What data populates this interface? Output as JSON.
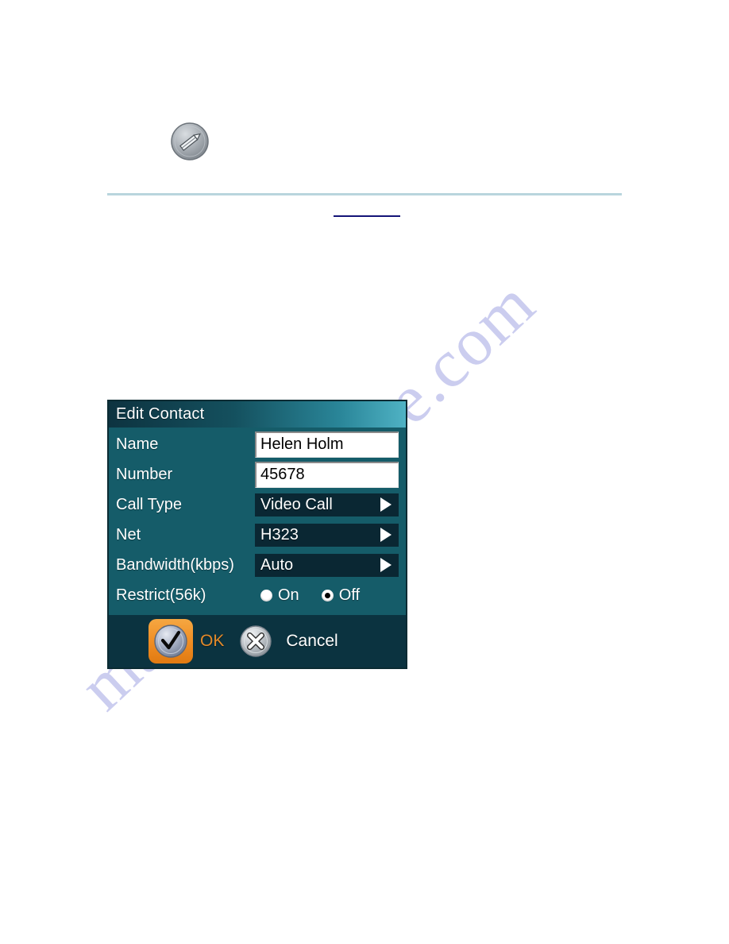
{
  "page": {
    "background_color": "#ffffff",
    "watermark_text": "manualsarchive.com",
    "rule_color": "#b9d5dd",
    "link_text": ""
  },
  "pencil_button": {
    "icon": "pencil-round-icon",
    "body_color": "#9aa0a6"
  },
  "dialog": {
    "title": "Edit Contact",
    "title_gradient_from": "#0d3340",
    "title_gradient_to": "#4fb2c4",
    "body_color": "#155c69",
    "footer_color": "#0b3340",
    "rows": [
      {
        "label": "Name",
        "type": "text",
        "value": "Helen Holm"
      },
      {
        "label": "Number",
        "type": "text",
        "value": "45678"
      },
      {
        "label": "Call Type",
        "type": "picker",
        "value": "Video Call"
      },
      {
        "label": "Net",
        "type": "picker",
        "value": "H323"
      },
      {
        "label": "Bandwidth(kbps)",
        "type": "picker",
        "value": "Auto"
      },
      {
        "label": "Restrict(56k)",
        "type": "radio"
      }
    ],
    "restrict_options": [
      {
        "label": "On",
        "selected": false
      },
      {
        "label": "Off",
        "selected": true
      }
    ],
    "actions": {
      "ok_label": "OK",
      "ok_icon": "checkmark-icon",
      "ok_accent": "#e2892a",
      "cancel_label": "Cancel",
      "cancel_icon": "close-x-icon"
    }
  }
}
